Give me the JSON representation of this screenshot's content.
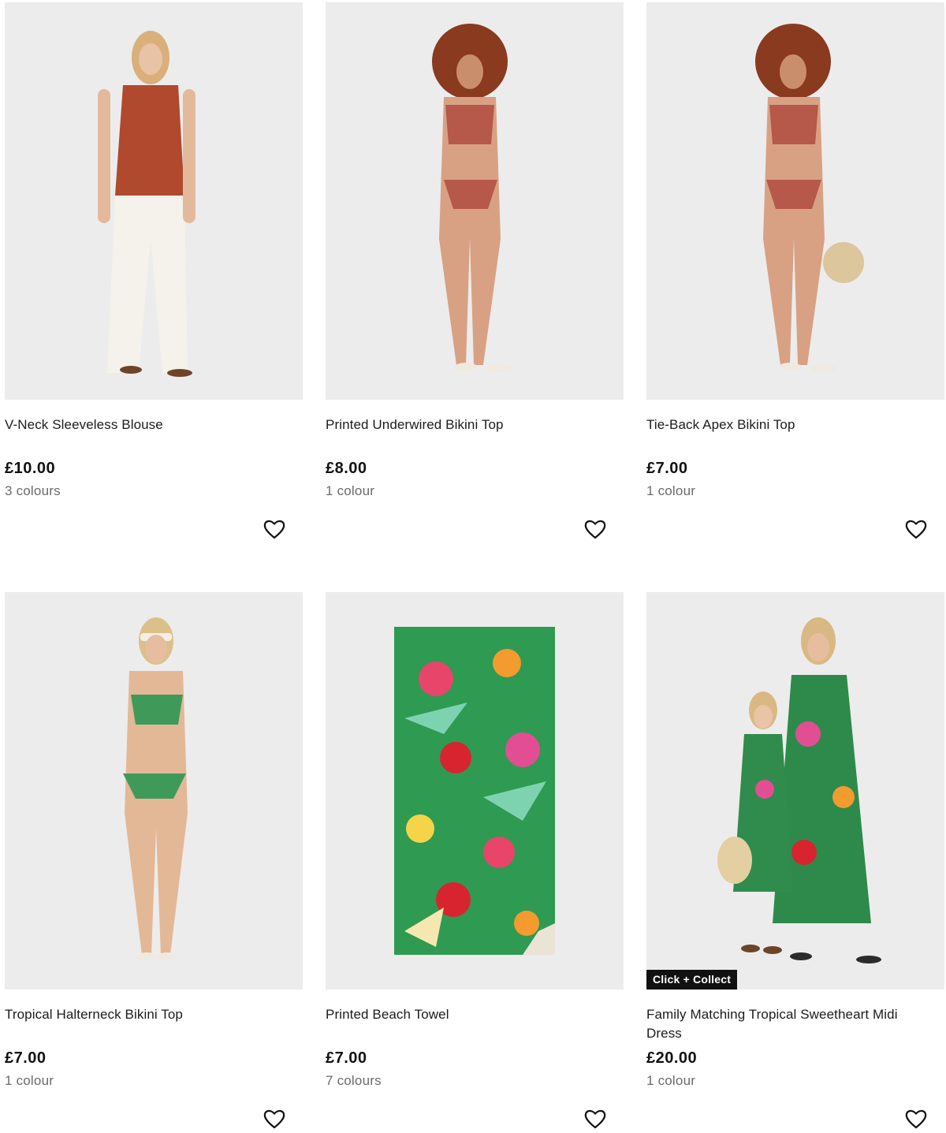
{
  "products": [
    {
      "name": "V-Neck Sleeveless Blouse",
      "price": "£10.00",
      "colours": "3 colours",
      "image_icon": "model-photo"
    },
    {
      "name": "Printed Underwired Bikini Top",
      "price": "£8.00",
      "colours": "1 colour",
      "image_icon": "model-photo"
    },
    {
      "name": "Tie-Back Apex Bikini Top",
      "price": "£7.00",
      "colours": "1 colour",
      "image_icon": "model-photo"
    },
    {
      "name": "Tropical Halterneck Bikini Top",
      "price": "£7.00",
      "colours": "1 colour",
      "image_icon": "model-photo"
    },
    {
      "name": "Printed Beach Towel",
      "price": "£7.00",
      "colours": "7 colours",
      "image_icon": "towel-photo"
    },
    {
      "name": "Family Matching Tropical Sweetheart Midi Dress",
      "price": "£20.00",
      "colours": "1 colour",
      "image_icon": "model-photo",
      "badge": "Click + Collect"
    }
  ],
  "icons": {
    "wishlist": "heart-outline-icon"
  },
  "colors": {
    "text": "#1b1b1b",
    "muted": "#6b6b6b",
    "badge_bg": "#111111",
    "image_bg": "#ececec"
  }
}
